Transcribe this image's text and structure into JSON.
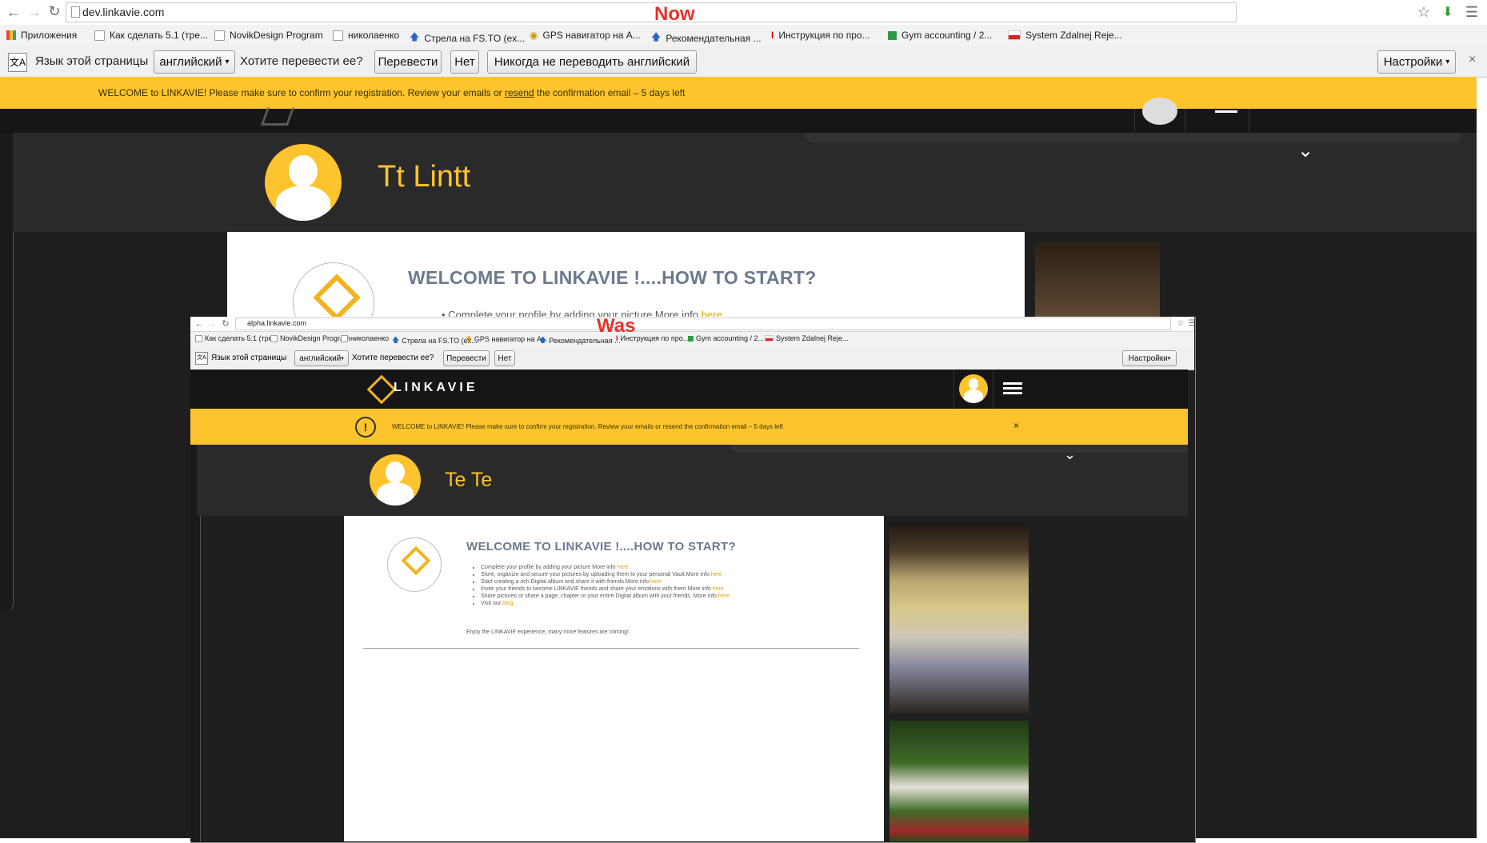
{
  "now": {
    "label": "Now",
    "url": "dev.linkavie.com",
    "bookmarks": [
      "Приложения",
      "Как сделать 5.1 (тре...",
      "NovikDesign Program",
      "николаенко",
      "Стрела на FS.TO (ex...",
      "GPS навигатор на А...",
      "Рекомендательная ...",
      "Инструкция по про...",
      "Gym accounting / 2...",
      "System Zdalnej Reje..."
    ],
    "translate": {
      "prompt": "Язык этой страницы",
      "language": "английский",
      "question": "Хотите перевести ее?",
      "translate_btn": "Перевести",
      "no_btn": "Нет",
      "never_btn": "Никогда не переводить английский",
      "settings_btn": "Настройки",
      "close": "×"
    },
    "banner": {
      "text_before": "WELCOME to LINKAVIE! Please make sure to confirm your registration. Review your emails or ",
      "link": "resend",
      "text_after": " the confirmation email – 5 days left"
    },
    "profile_name": "Tt Lintt",
    "card": {
      "title": "WELCOME TO LINKAVIE !....HOW TO START?",
      "first_item": "Complete your profile by adding your picture More info",
      "first_link": "here"
    }
  },
  "was": {
    "label": "Was",
    "url": "alpha.linkavie.com",
    "bookmarks": [
      "Как сделать 5.1 (тре...",
      "NovikDesign Program",
      "николаенко",
      "Стрела на FS.TO (ex...",
      "GPS навигатор на А...",
      "Рекомендательная ...",
      "Инструкция по про...",
      "Gym accounting / 2...",
      "System Zdalnej Reje..."
    ],
    "translate": {
      "prompt": "Язык этой страницы",
      "language": "английский",
      "question": "Хотите перевести ее?",
      "translate_btn": "Перевести",
      "no_btn": "Нет",
      "settings_btn": "Настройки"
    },
    "logo": "LINKAVIE",
    "banner": {
      "text": "WELCOME to LINKAVIE! Please make sure to confirm your registration. Review your emails or resend the confirmation email – 5 days left",
      "close": "×"
    },
    "profile_name": "Te Te",
    "card": {
      "title": "WELCOME TO LINKAVIE !....HOW TO START?",
      "items": [
        {
          "text": "Complete your profile by adding your picture More info ",
          "link": "here"
        },
        {
          "text": "Store, organize and secure your pictures by uploading them to your personal Vault.More info ",
          "link": "here"
        },
        {
          "text": "Start creating a rich Digital album and share it with friends.More info ",
          "link": "here"
        },
        {
          "text": "Invite your friends to become LINKAVIE friends and share your emotions with them More info ",
          "link": "here"
        },
        {
          "text": "Share pictures or share a page, chapter or your entire Digital album with your friends. More info ",
          "link": "here"
        },
        {
          "text": "Visit our ",
          "link": "blog"
        }
      ],
      "footer": "Enjoy the LINKAVIE experience, many more features are coming!"
    }
  },
  "colors": {
    "accent": "#fec42d",
    "dark": "#1e1e1e",
    "label": "#e8322a"
  }
}
